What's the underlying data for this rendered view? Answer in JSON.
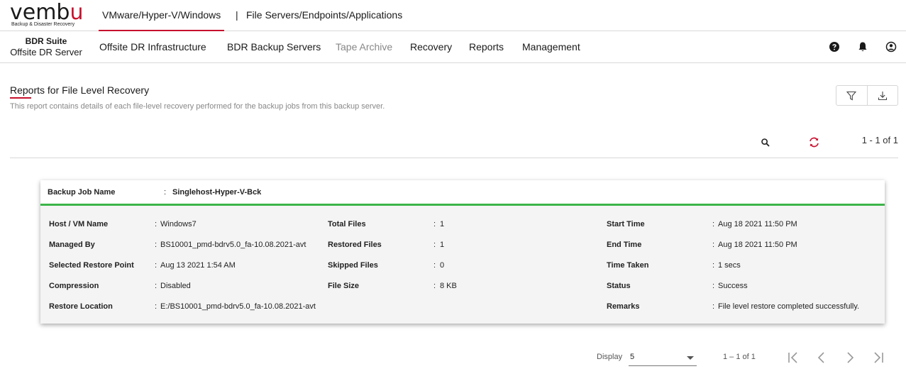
{
  "logo": {
    "word_main": "vemb",
    "word_accent": "u",
    "tagline": "Backup & Disaster Recovery"
  },
  "top_tabs": [
    {
      "label": "VMware/Hyper-V/Windows",
      "active": true
    },
    {
      "label": "File Servers/Endpoints/Applications",
      "active": false
    }
  ],
  "top_separator": "|",
  "brand": {
    "line1": "BDR Suite",
    "line2": "Offsite DR Server"
  },
  "nav": {
    "items": [
      {
        "label": "Offsite DR Infrastructure"
      },
      {
        "label": "BDR Backup Servers"
      },
      {
        "label": "Tape Archive",
        "disabled": true
      },
      {
        "label": "Recovery"
      },
      {
        "label": "Reports"
      },
      {
        "label": "Management"
      }
    ],
    "icons": [
      "help-icon",
      "bell-icon",
      "user-icon"
    ]
  },
  "page": {
    "title": "Reports for File Level Recovery",
    "description": "This report contains details of each file-level recovery performed for the backup jobs from this backup server.",
    "toolbar_icons": [
      "filter-icon",
      "download-icon"
    ],
    "pager_top": "1 - 1 of 1"
  },
  "card": {
    "job_label": "Backup Job Name",
    "job_value": "Singlehost-Hyper-V-Bck",
    "separator": ":",
    "col1": [
      {
        "label": "Host / VM Name",
        "value": "Windows7"
      },
      {
        "label": "Managed By",
        "value": "BS10001_pmd-bdrv5.0_fa-10.08.2021-avt"
      },
      {
        "label": "Selected Restore Point",
        "value": "Aug 13 2021 1:54 AM"
      },
      {
        "label": "Compression",
        "value": "Disabled"
      },
      {
        "label": "Restore Location",
        "value": "E:/BS10001_pmd-bdrv5.0_fa-10.08.2021-avt"
      }
    ],
    "col2": [
      {
        "label": "Total Files",
        "value": "1"
      },
      {
        "label": "Restored Files",
        "value": "1"
      },
      {
        "label": "Skipped Files",
        "value": "0"
      },
      {
        "label": "File Size",
        "value": "8 KB"
      }
    ],
    "col3": [
      {
        "label": "Start Time",
        "value": "Aug 18 2021 11:50 PM"
      },
      {
        "label": "End Time",
        "value": "Aug 18 2021 11:50 PM"
      },
      {
        "label": "Time Taken",
        "value": "1 secs"
      },
      {
        "label": "Status",
        "value": "Success"
      },
      {
        "label": "Remarks",
        "value": "File level restore completed successfully."
      }
    ]
  },
  "pagination": {
    "display_label": "Display",
    "display_value": "5",
    "range": "1 – 1 of 1",
    "buttons": [
      "first-page-icon",
      "prev-page-icon",
      "next-page-icon",
      "last-page-icon"
    ]
  },
  "colors": {
    "accent": "#c8102e",
    "success": "#3cb54a"
  }
}
